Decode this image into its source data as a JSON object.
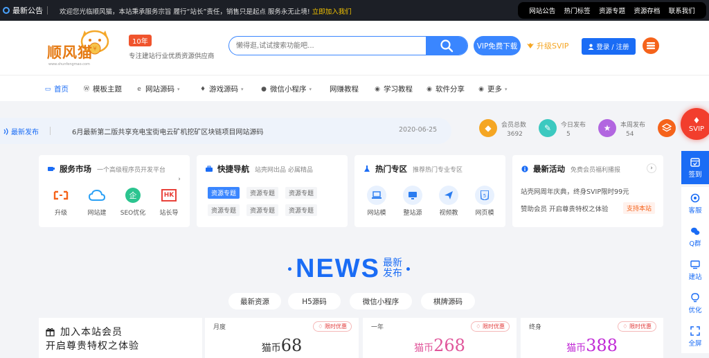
{
  "topbar": {
    "announce_label": "最新公告",
    "welcome_text": "欢迎您光临顺风猫，本站秉承服务宗旨 履行“站长”责任，销售只是起点 服务永无止境!",
    "join_link": "立即加入我们",
    "links": [
      "网站公告",
      "热门标签",
      "资源专题",
      "资源存档",
      "联系我们"
    ]
  },
  "header": {
    "logo_name": "顺风猫",
    "logo_url": "www.shunfengmao.com",
    "badge": "10年",
    "tagline": "专注建站行业优质资源供应商",
    "search_placeholder": "懒得逛,试试搜索功能吧...",
    "vip_button": "VIP免费下载",
    "svip_link": "升级SVIP",
    "login_button": "登录 / 注册"
  },
  "nav": {
    "items": [
      {
        "label": "首页",
        "icon": "monitor-icon",
        "dropdown": false
      },
      {
        "label": "模板主题",
        "icon": "wordpress-icon",
        "dropdown": false
      },
      {
        "label": "网站源码",
        "icon": "ie-icon",
        "dropdown": true
      },
      {
        "label": "游戏源码",
        "icon": "gamepad-icon",
        "dropdown": true
      },
      {
        "label": "微信小程序",
        "icon": "apple-icon",
        "dropdown": true
      },
      {
        "label": "网赚教程",
        "icon": "",
        "dropdown": false
      },
      {
        "label": "学习教程",
        "icon": "circle-dot-icon",
        "dropdown": false
      },
      {
        "label": "软件分享",
        "icon": "circle-dot-icon",
        "dropdown": false
      },
      {
        "label": "更多",
        "icon": "circle-dot-icon",
        "dropdown": true
      }
    ]
  },
  "ticker": {
    "label": "最新发布",
    "text": "6月最新第二版共享充电宝街电云矿机挖矿区块链项目网站源码",
    "date": "2020-06-25"
  },
  "stats": [
    {
      "label": "会员总数",
      "value": "3692",
      "color": "#f5a623",
      "icon": "diamond-icon"
    },
    {
      "label": "今日发布",
      "value": "5",
      "color": "#3cc9c0",
      "icon": "tag-icon"
    },
    {
      "label": "本周发布",
      "value": "54",
      "color": "#b266e0",
      "icon": "star-icon"
    }
  ],
  "svip_badge": "SVIP",
  "cards": {
    "service": {
      "title": "服务市场",
      "subtitle": "一个高级程序员开发平台",
      "items": [
        "升级",
        "网站建",
        "SEO优化",
        "站长导"
      ]
    },
    "quicknav": {
      "title": "快捷导航",
      "subtitle": "站壳网出品 必属精品",
      "tags": [
        "资源专题",
        "资源专题",
        "资源专题",
        "资源专题",
        "资源专题",
        "资源专题"
      ]
    },
    "hot": {
      "title": "热门专区",
      "subtitle": "推荐热门专业专区",
      "items": [
        "网站模",
        "整站源",
        "视频教",
        "网页模"
      ]
    },
    "activity": {
      "title": "最新活动",
      "subtitle": "免费会员福利播报",
      "line1": "站壳网周年庆典，终身SVIP限时99元",
      "line2": "赞助会员 开启尊贵特权之体验",
      "support": "支持本站"
    }
  },
  "news": {
    "big": "NEWS",
    "small1": "最新",
    "small2": "发布",
    "tabs": [
      "最新资源",
      "H5源码",
      "微信小程序",
      "棋牌源码"
    ]
  },
  "member": {
    "line1": "加入本站会员",
    "line2": "开启尊贵特权之体验"
  },
  "prices": [
    {
      "period": "月度",
      "badge": "限时优惠",
      "currency": "猫币",
      "amount": "68",
      "color": "#333333"
    },
    {
      "period": "一年",
      "badge": "限时优惠",
      "currency": "猫币",
      "amount": "268",
      "color": "#e0559a"
    },
    {
      "period": "终身",
      "badge": "限时优惠",
      "currency": "猫币",
      "amount": "388",
      "color": "#c02ad6"
    }
  ],
  "sidebar": [
    "签到",
    "客服",
    "Q群",
    "建站",
    "优化",
    "全屏"
  ],
  "colors": {
    "accent": "#1a6cf5",
    "orange": "#f5631b",
    "dark": "#1c1f26"
  }
}
